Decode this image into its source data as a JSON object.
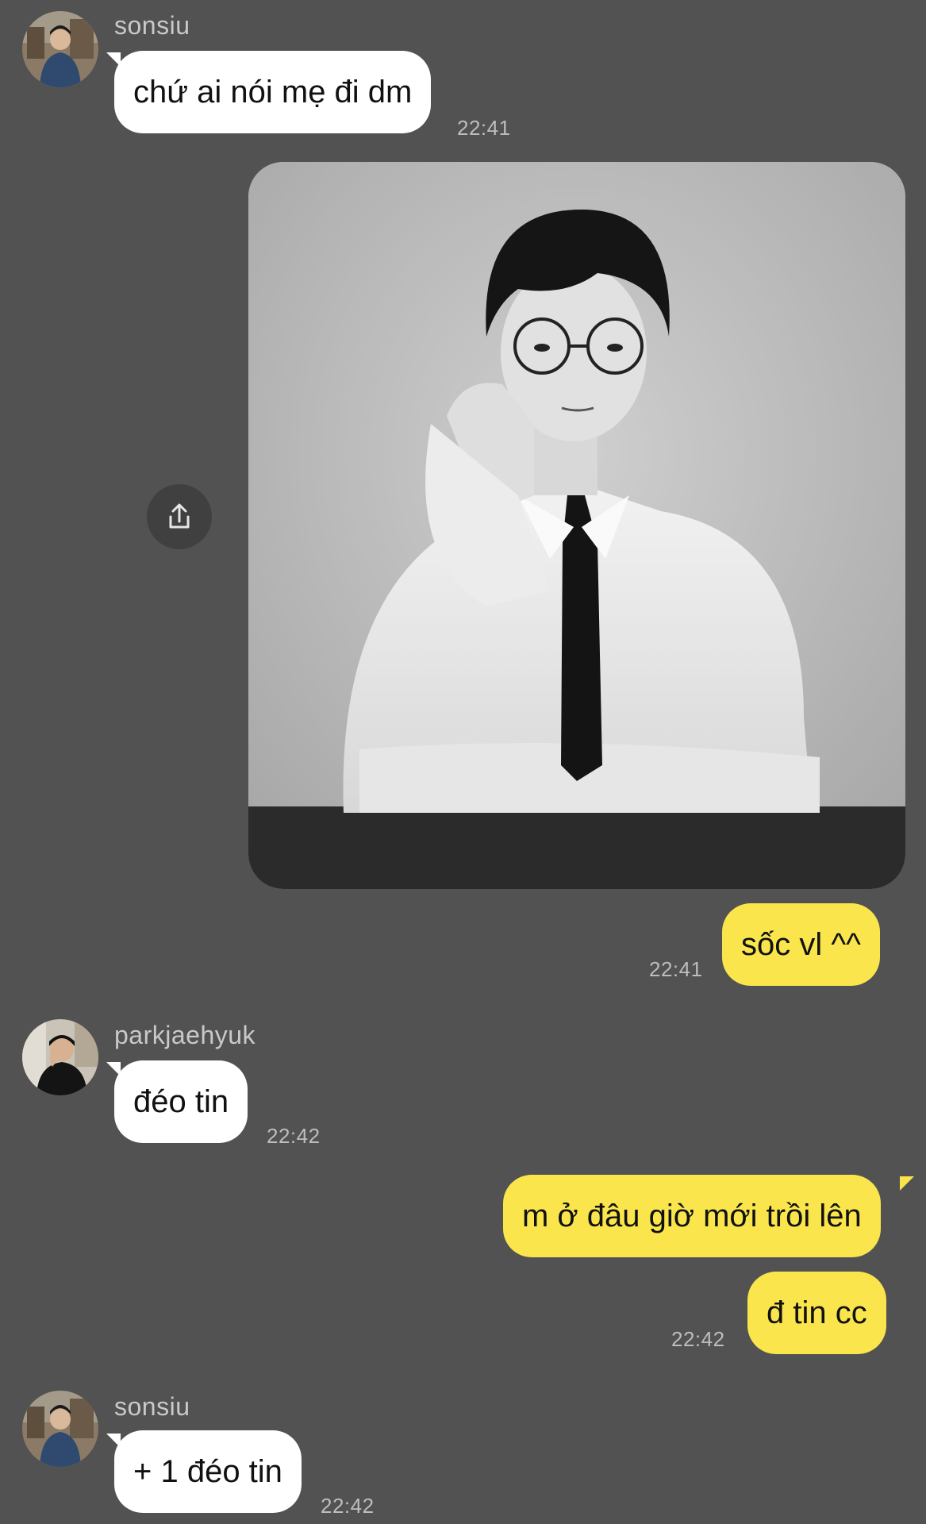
{
  "colors": {
    "background": "#525252",
    "incoming_bubble": "#ffffff",
    "outgoing_bubble": "#fae64c",
    "timestamp": "#bdbdbd",
    "sender_name": "#c9c9c9"
  },
  "messages": [
    {
      "direction": "incoming",
      "sender": "sonsiu",
      "text": "chứ ai nói mẹ đi dm",
      "time": "22:41"
    },
    {
      "direction": "outgoing",
      "type": "image",
      "image_desc": "black-and-white portrait photo"
    },
    {
      "direction": "outgoing",
      "text": "sốc vl ^^",
      "time": "22:41"
    },
    {
      "direction": "incoming",
      "sender": "parkjaehyuk",
      "text": "đéo tin",
      "time": "22:42"
    },
    {
      "direction": "outgoing",
      "text": "m ở đâu giờ mới trồi lên"
    },
    {
      "direction": "outgoing",
      "text": "đ tin cc",
      "time": "22:42"
    },
    {
      "direction": "incoming",
      "sender": "sonsiu",
      "text": "+ 1 đéo tin",
      "time": "22:42"
    }
  ],
  "icons": {
    "share": "share-icon",
    "avatar_sonsiu": "avatar-sonsiu",
    "avatar_parkjaehyuk": "avatar-parkjaehyuk"
  }
}
